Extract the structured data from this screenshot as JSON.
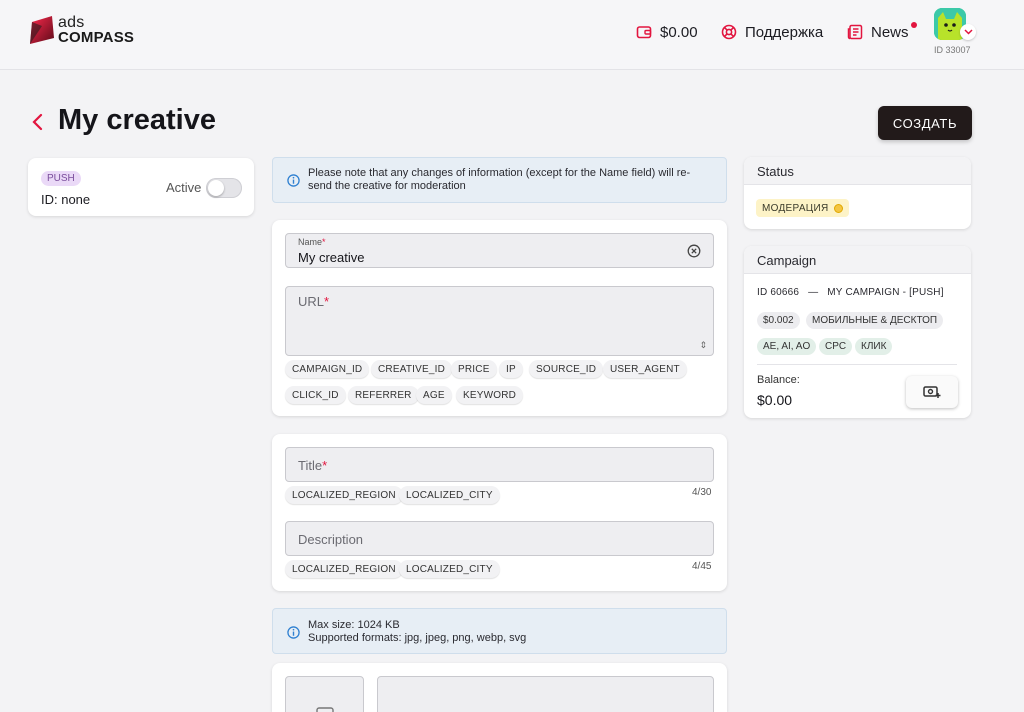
{
  "header": {
    "logo_top": "ads",
    "logo_bottom": "COMPASS",
    "balance": "$0.00",
    "support": "Поддержка",
    "news": "News",
    "user_id": "ID 33007"
  },
  "page": {
    "title": "My creative",
    "create_button": "СОЗДАТЬ"
  },
  "creative_card": {
    "badge": "PUSH",
    "id_text": "ID: none",
    "active_label": "Active"
  },
  "notice": {
    "line1": "Please note that any changes of information (except for the Name field) will re-",
    "line2": "send the creative for moderation"
  },
  "form": {
    "name_label": "Name",
    "name_required": "*",
    "name_value": "My creative",
    "url_placeholder": "URL",
    "url_required": "*",
    "url_macros": [
      "CAMPAIGN_ID",
      "CREATIVE_ID",
      "PRICE",
      "IP",
      "SOURCE_ID",
      "USER_AGENT",
      "CLICK_ID",
      "REFERRER",
      "AGE",
      "KEYWORD"
    ],
    "title_placeholder": "Title",
    "title_required": "*",
    "title_macros": [
      "LOCALIZED_REGION",
      "LOCALIZED_CITY"
    ],
    "title_counter": "4/30",
    "description_placeholder": "Description",
    "description_macros": [
      "LOCALIZED_REGION",
      "LOCALIZED_CITY"
    ],
    "description_counter": "4/45"
  },
  "image_notice": {
    "line1": "Max size: 1024 KB",
    "line2": "Supported formats: jpg, jpeg, png, webp, svg"
  },
  "status_card": {
    "title": "Status",
    "badge": "МОДЕРАЦИЯ"
  },
  "campaign_card": {
    "title": "Campaign",
    "id": "ID 60666",
    "separator": "—",
    "name": "MY CAMPAIGN - [PUSH]",
    "tags_row1": [
      "$0.002",
      "МОБИЛЬНЫЕ & ДЕСКТОП"
    ],
    "tags_row2": [
      "AE, AI, AO",
      "CPC",
      "КЛИК"
    ],
    "balance_label": "Balance:",
    "balance_value": "$0.00"
  },
  "colors": {
    "accent_red": "#e2153f",
    "dark_button": "#221a1a",
    "info_bg": "#e7eef5",
    "badge_purple": "#ead9f7",
    "badge_yellow": "#fdf3c7"
  }
}
